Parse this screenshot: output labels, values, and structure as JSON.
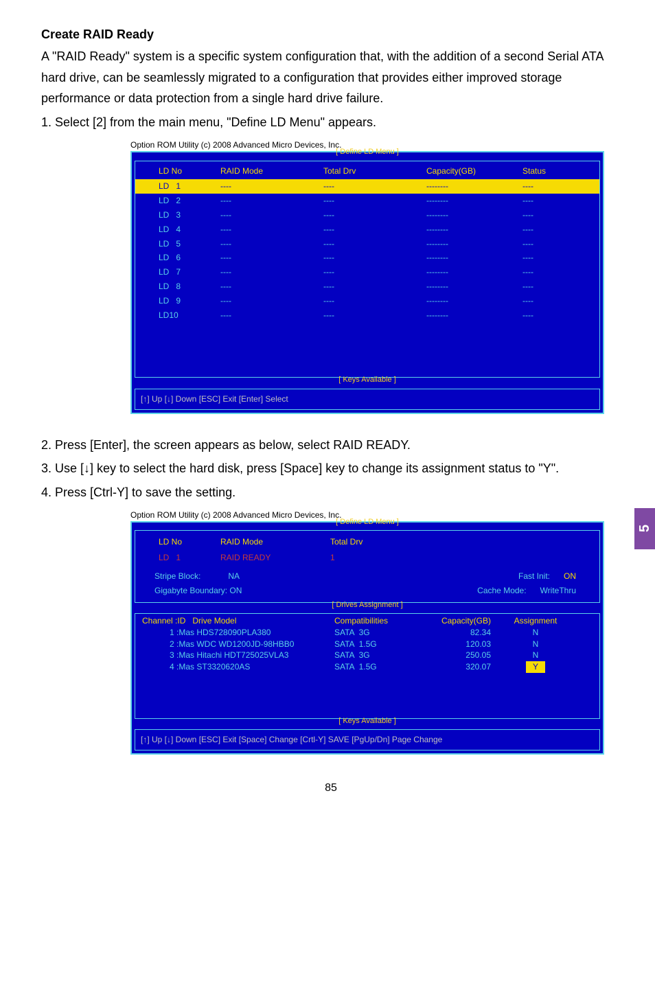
{
  "side_tab": "5",
  "heading": "Create RAID Ready",
  "intro": "A \"RAID Ready\" system is a specific system configuration that, with the addition of a second Serial ATA hard drive, can be seamlessly migrated to a configuration that provides either improved storage performance or data protection from a single hard drive failure.",
  "step1": "1. Select [2] from the main menu, \"Define LD Menu\" appears.",
  "step2": "2. Press [Enter], the screen appears as below, select RAID READY.",
  "step3": "3. Use [↓] key to select the hard disk, press [Space] key to change its assignment status to \"Y\".",
  "step4": "4. Press [Ctrl-Y] to save the setting.",
  "page_num": "85",
  "bios1": {
    "rom_title": "Option ROM Utility (c) 2008 Advanced Micro Devices, Inc.",
    "menu_label": "[ Define LD Menu ]",
    "headers": {
      "c1": "LD No",
      "c2": "RAID Mode",
      "c3": "Total Drv",
      "c4": "Capacity(GB)",
      "c5": "Status"
    },
    "rows": [
      {
        "c1": "LD   1",
        "c2": "----",
        "c3": "----",
        "c4": "--------",
        "c5": "----",
        "selected": true
      },
      {
        "c1": "LD   2",
        "c2": "----",
        "c3": "----",
        "c4": "--------",
        "c5": "----"
      },
      {
        "c1": "LD   3",
        "c2": "----",
        "c3": "----",
        "c4": "--------",
        "c5": "----"
      },
      {
        "c1": "LD   4",
        "c2": "----",
        "c3": "----",
        "c4": "--------",
        "c5": "----"
      },
      {
        "c1": "LD   5",
        "c2": "----",
        "c3": "----",
        "c4": "--------",
        "c5": "----"
      },
      {
        "c1": "LD   6",
        "c2": "----",
        "c3": "----",
        "c4": "--------",
        "c5": "----"
      },
      {
        "c1": "LD   7",
        "c2": "----",
        "c3": "----",
        "c4": "--------",
        "c5": "----"
      },
      {
        "c1": "LD   8",
        "c2": "----",
        "c3": "----",
        "c4": "--------",
        "c5": "----"
      },
      {
        "c1": "LD   9",
        "c2": "----",
        "c3": "----",
        "c4": "--------",
        "c5": "----"
      },
      {
        "c1": "LD10",
        "c2": "----",
        "c3": "----",
        "c4": "--------",
        "c5": "----"
      }
    ],
    "keys_label": "[ Keys Available ]",
    "keys": "[↑] Up    [↓] Down    [ESC] Exit    [Enter] Select"
  },
  "bios2": {
    "rom_title": "Option ROM Utility (c) 2008 Advanced Micro Devices, Inc.",
    "menu_label": "[ Define LD Menu ]",
    "headers": {
      "d1": "LD No",
      "d2": "RAID Mode",
      "d3": "Total Drv"
    },
    "row": {
      "d1": "LD   1",
      "d2": "RAID READY",
      "d3": "1"
    },
    "stripe1": {
      "l1": "Stripe Block:",
      "v1": "NA",
      "r1": "Fast Init:",
      "rv1": "ON"
    },
    "stripe2": {
      "l1": "Gigabyte Boundary: ON",
      "r1": "Cache Mode:",
      "rv1": "WriteThru"
    },
    "drives_label": "[ Drives Assignment ]",
    "drives_hdr": {
      "e1": "Channel :ID   Drive Model",
      "e2": "Compatibilities",
      "e3": "Capacity(GB)",
      "e4": "Assignment"
    },
    "drives": [
      {
        "e1": "            1 :Mas HDS728090PLA380",
        "e2": "SATA  3G",
        "e3": "82.34",
        "e4": "N"
      },
      {
        "e1": "            2 :Mas WDC WD1200JD-98HBB0",
        "e2": "SATA  1.5G",
        "e3": "120.03",
        "e4": "N"
      },
      {
        "e1": "            3 :Mas Hitachi HDT725025VLA3",
        "e2": "SATA  3G",
        "e3": "250.05",
        "e4": "N"
      },
      {
        "e1": "            4 :Mas ST3320620AS",
        "e2": "SATA  1.5G",
        "e3": "320.07",
        "e4": "Y",
        "y": true
      }
    ],
    "keys_label": "[ Keys Available ]",
    "keys": "[↑] Up  [↓] Down  [ESC] Exit  [Space] Change  [Crtl-Y] SAVE   [PgUp/Dn] Page Change"
  }
}
